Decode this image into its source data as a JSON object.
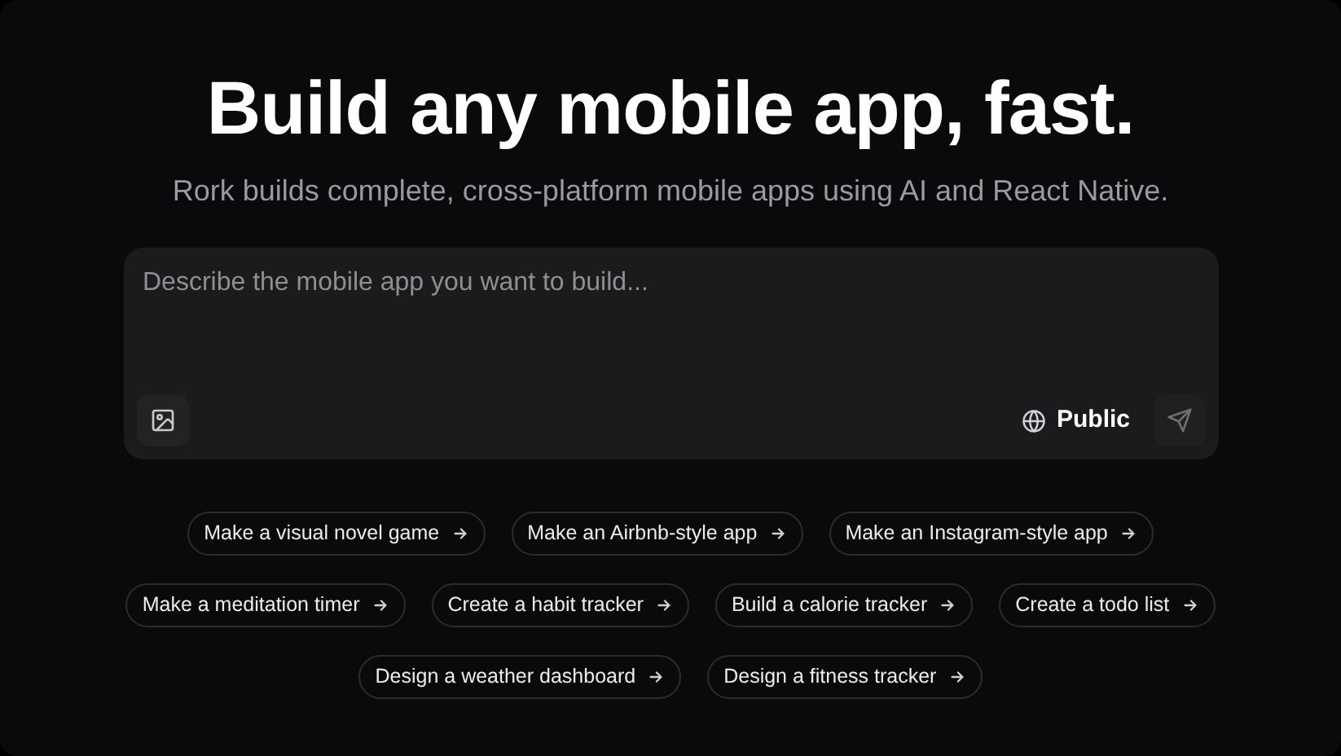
{
  "hero": {
    "title": "Build any mobile app, fast.",
    "subtitle": "Rork builds complete, cross-platform mobile apps using AI and React Native."
  },
  "prompt": {
    "placeholder": "Describe the mobile app you want to build...",
    "visibility": "Public"
  },
  "suggestion_rows": [
    {
      "items": [
        "Make a visual novel game",
        "Make an Airbnb-style app",
        "Make an Instagram-style app"
      ]
    },
    {
      "items": [
        "Make a meditation timer",
        "Create a habit tracker",
        "Build a calorie tracker",
        "Create a todo list"
      ]
    },
    {
      "items": [
        "Design a weather dashboard",
        "Design a fitness tracker"
      ]
    }
  ]
}
